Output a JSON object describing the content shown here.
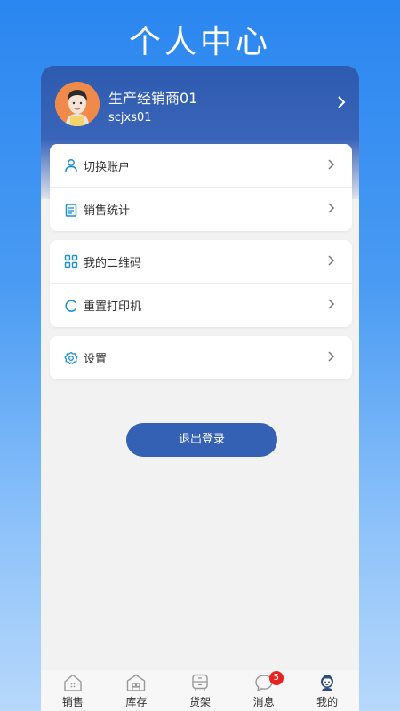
{
  "page": {
    "title": "个人中心"
  },
  "profile": {
    "name": "生产经销商01",
    "account": "scjxs01"
  },
  "menu_groups": [
    [
      {
        "label": "切换账户",
        "icon": "user-icon"
      },
      {
        "label": "销售统计",
        "icon": "clipboard-icon"
      }
    ],
    [
      {
        "label": "我的二维码",
        "icon": "qrcode-icon"
      },
      {
        "label": "重置打印机",
        "icon": "refresh-icon"
      }
    ],
    [
      {
        "label": "设置",
        "icon": "settings-icon"
      }
    ]
  ],
  "logout_label": "退出登录",
  "tabbar": {
    "tabs": [
      {
        "label": "销售",
        "icon": "home-icon"
      },
      {
        "label": "库存",
        "icon": "warehouse-icon"
      },
      {
        "label": "货架",
        "icon": "shelf-icon"
      },
      {
        "label": "消息",
        "icon": "message-icon",
        "badge": "5"
      },
      {
        "label": "我的",
        "icon": "profile-icon",
        "active": true
      }
    ]
  },
  "colors": {
    "accent": "#3461b3",
    "icon": "#1b8fd6",
    "badge": "#e8231f"
  }
}
